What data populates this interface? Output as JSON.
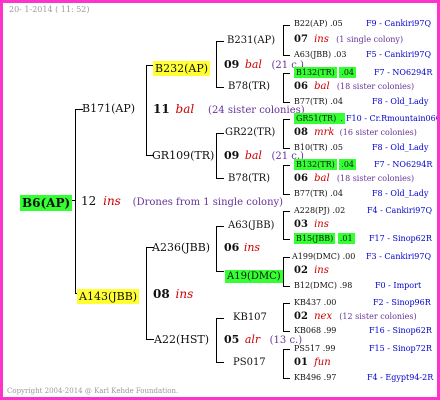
{
  "colors": {
    "border": "#ff33cc",
    "yellow_highlight": "#ffff33",
    "green_highlight": "#33ff33",
    "red_text": "#cc0000",
    "purple_text": "#663399",
    "blue_text": "#0000cc"
  },
  "header": {
    "date": "20- 1-2014 ( 11: 52)"
  },
  "footer": {
    "copyright": "Copyright 2004-2014 @ Karl Kehde Foundation."
  },
  "root": {
    "label": "B6(AP)",
    "num": "12",
    "tag": "ins",
    "note": "(Drones from 1 single colony)"
  },
  "g1": [
    {
      "label": "B171(AP)",
      "num": "11",
      "tag": "bal",
      "note": "(24 sister colonies)"
    },
    {
      "label": "A143(JBB)",
      "num": "08",
      "tag": "ins",
      "note": ""
    }
  ],
  "g2": [
    {
      "label": "B232(AP)",
      "num": "09",
      "tag": "bal",
      "note": "(21 c.)"
    },
    {
      "label": "GR109(TR)",
      "num": "09",
      "tag": "bal",
      "note": "(21 c.)"
    },
    {
      "label": "A236(JBB)",
      "num": "06",
      "tag": "ins",
      "note": ""
    },
    {
      "label": "A22(HST)",
      "num": "05",
      "tag": "alr",
      "note": "(13 c.)"
    }
  ],
  "g3": [
    {
      "label": "B231(AP)",
      "num": "07",
      "tag": "ins",
      "note": "(1 single colony)"
    },
    {
      "label": "B78(TR)",
      "num": "06",
      "tag": "bal",
      "note": "(18 sister colonies)"
    },
    {
      "label": "GR22(TR)",
      "num": "08",
      "tag": "mrk",
      "note": "(16 sister colonies)"
    },
    {
      "label": "B78(TR)",
      "num": "06",
      "tag": "bal",
      "note": "(18 sister colonies)"
    },
    {
      "label": "A63(JBB)",
      "num": "03",
      "tag": "ins",
      "note": ""
    },
    {
      "label": "A19(DMC)",
      "num": "02",
      "tag": "ins",
      "note": ""
    },
    {
      "label": "KB107",
      "num": "02",
      "tag": "nex",
      "note": "(12 sister colonies)"
    },
    {
      "label": "PS017",
      "num": "01",
      "tag": "fun",
      "note": ""
    }
  ],
  "g4": [
    {
      "label": "B22(AP)",
      "val": ".05",
      "right": "F9 - Cankiri97Q"
    },
    {
      "label": "A63(JBB)",
      "val": ".03",
      "right": "F5 - Cankiri97Q"
    },
    {
      "label": "B132(TR)",
      "val": ".04",
      "right": "F7 - NO6294R"
    },
    {
      "label": "B77(TR)",
      "val": ".04",
      "right": "F8 - Old_Lady"
    },
    {
      "label": "GR51(TR)",
      "val": ".",
      "right": "F10 - Cr.Rmountain06Q"
    },
    {
      "label": "B10(TR)",
      "val": ".05",
      "right": "F8 - Old_Lady"
    },
    {
      "label": "B132(TR)",
      "val": ".04",
      "right": "F7 - NO6294R"
    },
    {
      "label": "B77(TR)",
      "val": ".04",
      "right": "F8 - Old_Lady"
    },
    {
      "label": "A228(PJ)",
      "val": ".02",
      "right": "F4 - Cankiri97Q"
    },
    {
      "label": "B15(JBB)",
      "val": ".01",
      "right": "F17 - Sinop62R"
    },
    {
      "label": "A199(DMC)",
      "val": ".00",
      "right": "F3 - Cankiri97Q"
    },
    {
      "label": "B12(DMC)",
      "val": ".98",
      "right": "F0 - Import"
    },
    {
      "label": "KB437",
      "val": ".00",
      "right": "F2 - Sinop96R"
    },
    {
      "label": "KB068",
      "val": ".99",
      "right": "F16 - Sinop62R"
    },
    {
      "label": "PS517",
      "val": ".99",
      "right": "F15 - Sinop72R"
    },
    {
      "label": "KB496",
      "val": ".97",
      "right": "F4 - Egypt94-2R"
    }
  ]
}
